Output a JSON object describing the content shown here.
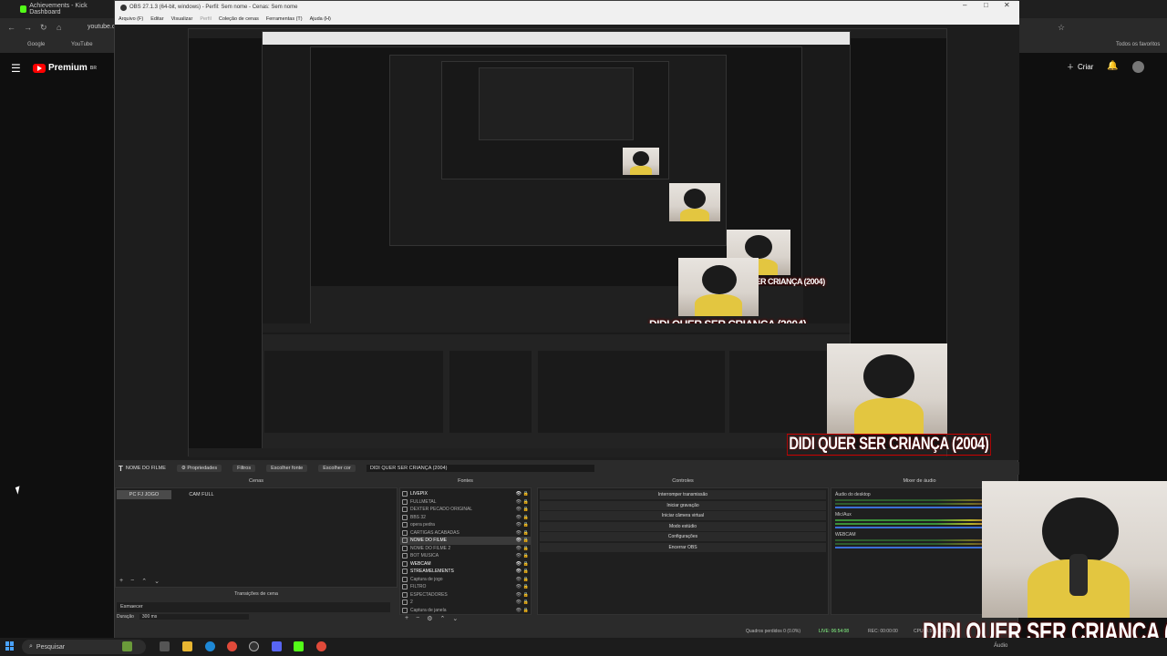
{
  "browser": {
    "tab_title": "Achievements - Kick Dashboard",
    "url": "youtube.c",
    "bookmarks": [
      "Google",
      "YouTube"
    ],
    "favorites_label": "Todos os favoritos",
    "yt_logo": "Premium",
    "yt_logo_sup": "BR",
    "criar_label": "Criar"
  },
  "obs": {
    "window_title": "OBS 27.1.3 (64-bit, windows) - Perfil: Sem nome - Cenas: Sem nome",
    "menu": [
      "Arquivo (F)",
      "Editar",
      "Visualizar",
      "Perfil",
      "Coleção de cenas",
      "Ferramentas (T)",
      "Ajuda (H)"
    ],
    "source_bar": {
      "selected_source": "NOME DO FILME",
      "properties": "Propriedades",
      "filters": "Filtros",
      "choose_font": "Escolher fonte",
      "choose_color": "Escolher cor",
      "text_value": "DIDI QUER SER CRIANÇA (2004)"
    },
    "docks": {
      "scenes_title": "Cenas",
      "sources_title": "Fontes",
      "controls_title": "Controles",
      "mixer_title": "Mixer de áudio",
      "transitions_title": "Transições de cena"
    },
    "scenes": [
      "PC FJ JOGO",
      "CAM FULL"
    ],
    "sources": [
      {
        "name": "LIVEPIX",
        "on": true
      },
      {
        "name": "FULLMETAL",
        "on": false
      },
      {
        "name": "DEXTER PECADO ORIGINAL",
        "on": false
      },
      {
        "name": "BBS 32",
        "on": false
      },
      {
        "name": "opera pedra",
        "on": false
      },
      {
        "name": "CARTIGAS ACABADAS",
        "on": false
      },
      {
        "name": "NOME DO FILME",
        "on": true
      },
      {
        "name": "NOME DO FILME 2",
        "on": false
      },
      {
        "name": "BOT MUSICA",
        "on": false
      },
      {
        "name": "WEBCAM",
        "on": true
      },
      {
        "name": "STREAMELEMENTS",
        "on": true
      },
      {
        "name": "Captura de jogo",
        "on": false
      },
      {
        "name": "FILTRO",
        "on": false
      },
      {
        "name": "ESPECTADORES",
        "on": false
      },
      {
        "name": "2",
        "on": false
      },
      {
        "name": "Captura de janela",
        "on": false
      }
    ],
    "controls": [
      "Interromper transmissão",
      "Iniciar gravação",
      "Iniciar câmera virtual",
      "Modo estúdio",
      "Configurações",
      "Encerrar OBS"
    ],
    "mixer": [
      {
        "name": "Áudio do desktop",
        "active": false
      },
      {
        "name": "Mic/Aux",
        "active": true
      },
      {
        "name": "WEBCAM",
        "active": false
      }
    ],
    "transition": {
      "type": "Esmaecer",
      "duration_label": "Duração",
      "duration": "300 ms"
    },
    "status": {
      "dropped": "Quadros perdidos 0 (0.0%)",
      "live": "LIVE: 06:54:08",
      "rec": "REC: 00:00:00",
      "cpu": "CPU: 4.5%, 60.00 fps"
    }
  },
  "overlay": {
    "caption": "DIDI QUER SER CRIANÇA (2004)"
  },
  "taskbar": {
    "search_placeholder": "Pesquisar",
    "tray_audio": "Áudio"
  }
}
